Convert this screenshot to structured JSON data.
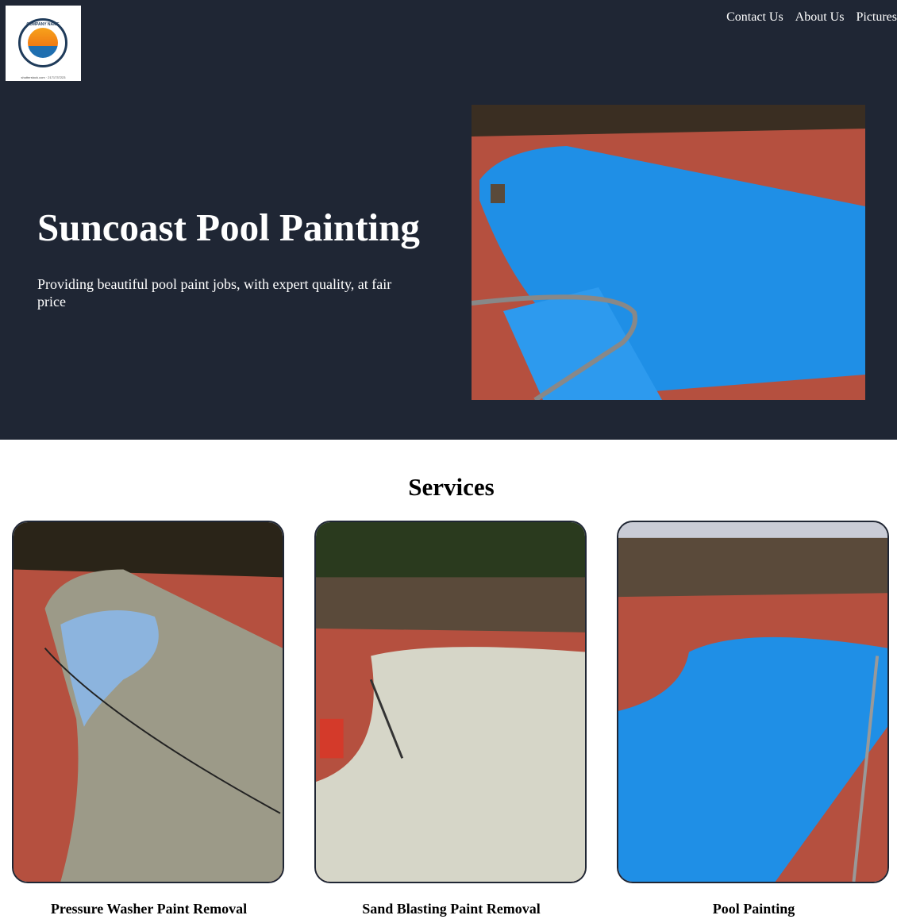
{
  "logo": {
    "brand_text": "COMPANY NAME",
    "caption": "shutterstock.com · 2171737223"
  },
  "nav": {
    "items": [
      "Contact Us",
      "About Us",
      "Pictures"
    ]
  },
  "hero": {
    "title": "Suncoast Pool Painting",
    "subtitle": "Providing beautiful pool paint jobs, with expert quality, at fair price"
  },
  "services": {
    "title": "Services",
    "items": [
      {
        "label": "Pressure Washer Paint Removal"
      },
      {
        "label": "Sand Blasting Paint Removal"
      },
      {
        "label": "Pool Painting"
      }
    ]
  },
  "colors": {
    "header_bg": "#1f2634",
    "pool_blue": "#1f8fe6",
    "brick": "#b5503f",
    "text_light": "#ffffff"
  }
}
